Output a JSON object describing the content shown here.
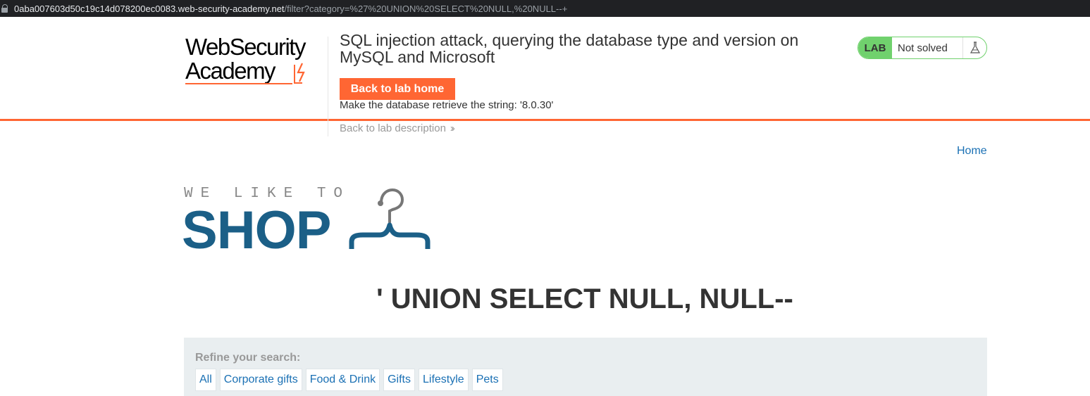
{
  "browser": {
    "url_host": "0aba007603d50c19c14d078200ec0083.web-security-academy.net",
    "url_path": "/filter?category=%27%20UNION%20SELECT%20NULL,%20NULL--+"
  },
  "academy": {
    "logo_line1": "WebSecurity",
    "logo_line2": "Academy",
    "lab_title": "SQL injection attack, querying the database type and version on MySQL and Microsoft",
    "back_home_label": "Back to lab home",
    "instruction": "Make the database retrieve the string: '8.0.30'",
    "back_description_label": "Back to lab description",
    "lab_badge": "LAB",
    "lab_status": "Not solved",
    "accent_color": "#ff6633",
    "status_color": "#70d16d"
  },
  "shop": {
    "nav_home": "Home",
    "logo_tagline": "WE LIKE TO",
    "logo_word": "SHOP",
    "category_heading": "' UNION SELECT NULL, NULL--",
    "refine_label": "Refine your search:",
    "filters": [
      "All",
      "Corporate gifts",
      "Food & Drink",
      "Gifts",
      "Lifestyle",
      "Pets"
    ]
  }
}
